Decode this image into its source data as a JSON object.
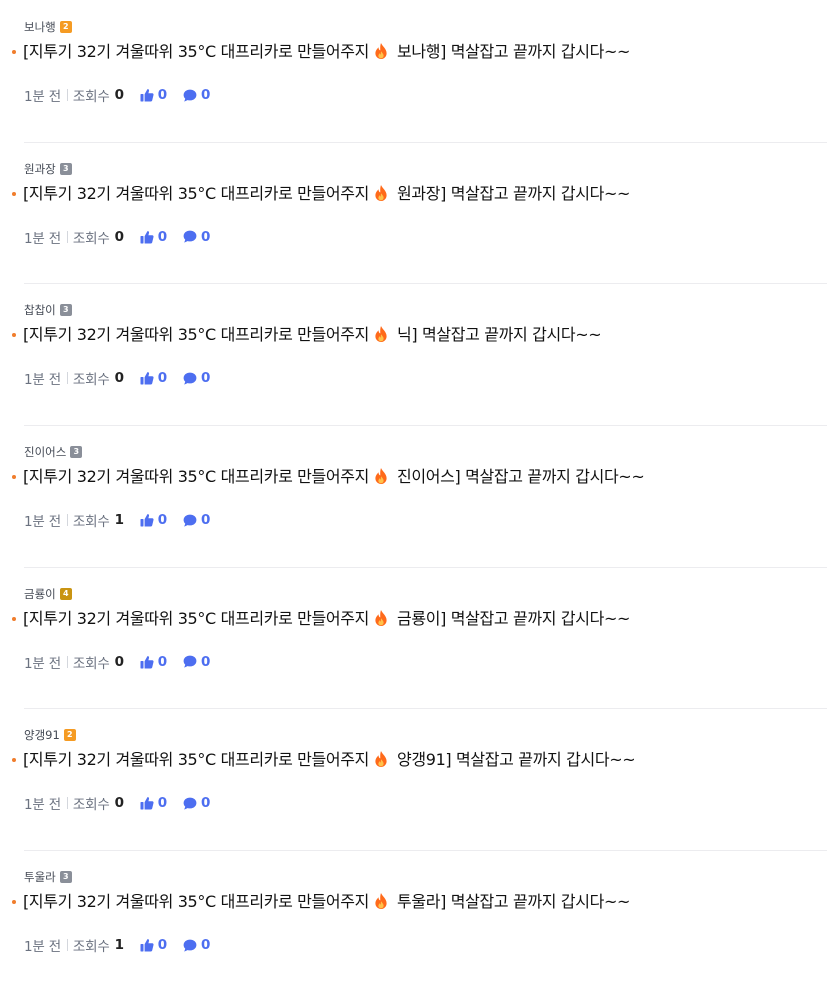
{
  "posts": [
    {
      "author": "보나행",
      "level": "2",
      "level_color": "#f59b23",
      "title_prefix": "[지투기 32기 겨울따위 35°C 대프리카로 만들어주지",
      "title_suffix": "보나행] 멱살잡고 끝까지 갑시다~~",
      "time": "1분 전",
      "views_label": "조회수",
      "views": "0",
      "likes": "0",
      "comments": "0"
    },
    {
      "author": "원과장",
      "level": "3",
      "level_color": "#8a8f99",
      "title_prefix": "[지투기 32기 겨울따위 35°C 대프리카로 만들어주지",
      "title_suffix": "원과장] 멱살잡고 끝까지 갑시다~~",
      "time": "1분 전",
      "views_label": "조회수",
      "views": "0",
      "likes": "0",
      "comments": "0"
    },
    {
      "author": "찹찹이",
      "level": "3",
      "level_color": "#8a8f99",
      "title_prefix": "[지투기 32기 겨울따위 35°C 대프리카로 만들어주지",
      "title_suffix": "닉] 멱살잡고 끝까지 갑시다~~",
      "time": "1분 전",
      "views_label": "조회수",
      "views": "0",
      "likes": "0",
      "comments": "0"
    },
    {
      "author": "진이어스",
      "level": "3",
      "level_color": "#8a8f99",
      "title_prefix": "[지투기 32기 겨울따위 35°C 대프리카로 만들어주지",
      "title_suffix": "진이어스] 멱살잡고 끝까지 갑시다~~",
      "time": "1분 전",
      "views_label": "조회수",
      "views": "1",
      "likes": "0",
      "comments": "0"
    },
    {
      "author": "금룡이",
      "level": "4",
      "level_color": "#c99412",
      "title_prefix": "[지투기 32기 겨울따위 35°C 대프리카로 만들어주지",
      "title_suffix": "금룡이] 멱살잡고 끝까지 갑시다~~",
      "time": "1분 전",
      "views_label": "조회수",
      "views": "0",
      "likes": "0",
      "comments": "0"
    },
    {
      "author": "양갱91",
      "level": "2",
      "level_color": "#f59b23",
      "title_prefix": "[지투기 32기 겨울따위 35°C 대프리카로 만들어주지",
      "title_suffix": "양갱91] 멱살잡고 끝까지 갑시다~~",
      "time": "1분 전",
      "views_label": "조회수",
      "views": "0",
      "likes": "0",
      "comments": "0"
    },
    {
      "author": "투울라",
      "level": "3",
      "level_color": "#8a8f99",
      "title_prefix": "[지투기 32기 겨울따위 35°C 대프리카로 만들어주지",
      "title_suffix": "투울라] 멱살잡고 끝까지 갑시다~~",
      "time": "1분 전",
      "views_label": "조회수",
      "views": "1",
      "likes": "0",
      "comments": "0"
    }
  ],
  "icons": {
    "emoji": "fire-icon",
    "likes": "thumbs-up-icon",
    "comments": "comment-bubble-icon"
  },
  "colors": {
    "bullet": "#f07d2c",
    "stat": "#4d6ef0",
    "level_2": "#f59b23",
    "level_3": "#8a8f99",
    "level_4": "#c99412"
  }
}
